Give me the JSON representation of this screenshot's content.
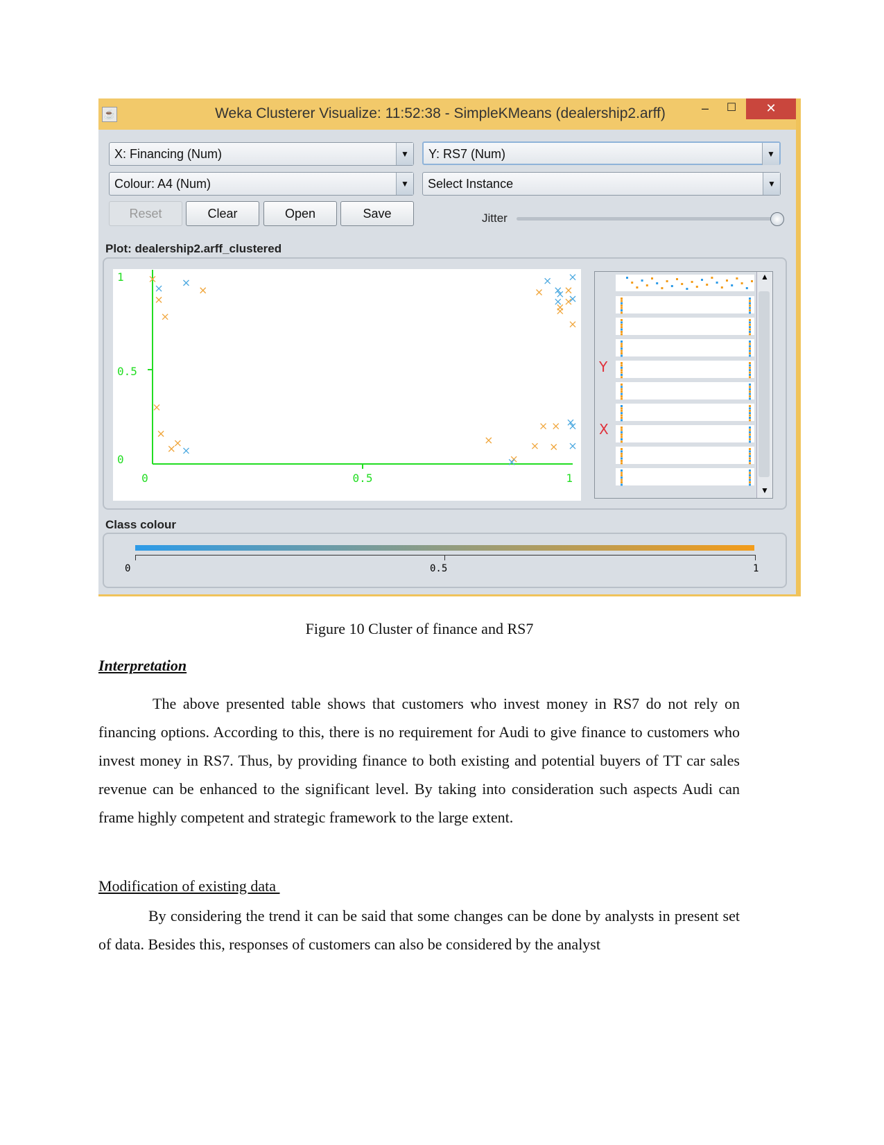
{
  "window": {
    "title": "Weka Clusterer Visualize: 11:52:38 - SimpleKMeans (dealership2.arff)",
    "minimize_glyph": "–",
    "maximize_glyph": "☐",
    "close_glyph": "✕",
    "x_combo": "X: Financing (Num)",
    "y_combo": "Y: RS7 (Num)",
    "colour_combo": "Colour: A4 (Num)",
    "instance_combo": "Select Instance",
    "buttons": {
      "reset": "Reset",
      "clear": "Clear",
      "open": "Open",
      "save": "Save"
    },
    "jitter_label": "Jitter",
    "jitter_value": 1.0,
    "plot_label": "Plot: dealership2.arff_clustered",
    "side_y_label": "Y",
    "side_x_label": "X",
    "class_colour_label": "Class colour",
    "class_colour_ticks": [
      "0",
      "0.5",
      "1"
    ],
    "colors": {
      "low": "#2d9be8",
      "high": "#f39c1a",
      "axis": "#22dd22",
      "titlebar": "#f2c96a"
    }
  },
  "chart_data": {
    "type": "scatter",
    "xlim": [
      0,
      1
    ],
    "ylim": [
      0,
      1
    ],
    "x_ticks": [
      "0",
      "0.5",
      "1"
    ],
    "y_ticks": [
      "0",
      "0.5",
      "1"
    ],
    "series": [
      {
        "color": "#f0a53a",
        "points": [
          [
            0.0,
            0.98
          ],
          [
            0.12,
            0.92
          ],
          [
            0.015,
            0.87
          ],
          [
            0.03,
            0.78
          ],
          [
            0.01,
            0.3
          ],
          [
            0.02,
            0.16
          ],
          [
            0.06,
            0.11
          ],
          [
            0.045,
            0.08
          ],
          [
            0.92,
            0.91
          ],
          [
            0.99,
            0.92
          ],
          [
            0.97,
            0.83
          ],
          [
            0.99,
            0.86
          ],
          [
            0.97,
            0.81
          ],
          [
            1.0,
            0.74
          ],
          [
            0.93,
            0.2
          ],
          [
            0.96,
            0.2
          ],
          [
            0.8,
            0.125
          ],
          [
            0.91,
            0.095
          ],
          [
            0.955,
            0.09
          ],
          [
            0.86,
            0.025
          ]
        ]
      },
      {
        "color": "#4aa8e0",
        "points": [
          [
            0.015,
            0.93
          ],
          [
            0.08,
            0.96
          ],
          [
            0.08,
            0.07
          ],
          [
            0.94,
            0.97
          ],
          [
            1.0,
            0.99
          ],
          [
            0.965,
            0.92
          ],
          [
            0.97,
            0.9
          ],
          [
            1.0,
            0.875
          ],
          [
            0.965,
            0.86
          ],
          [
            0.995,
            0.22
          ],
          [
            1.0,
            0.2
          ],
          [
            1.0,
            0.095
          ],
          [
            0.855,
            0.01
          ]
        ]
      }
    ]
  },
  "document": {
    "caption": "Figure 10 Cluster of finance and RS7",
    "heading1": "Interpretation",
    "para1": "The above presented table shows that customers who invest money in RS7 do not rely on financing options. According to this, there is no requirement for Audi to give finance to customers who invest money in RS7. Thus, by providing finance to both existing and potential buyers of TT car sales revenue can be enhanced to the significant level. By taking into consideration such aspects Audi can frame highly competent and strategic framework to the large extent.",
    "heading2": "Modification of existing data ",
    "para2": "By considering the trend it can be said that some changes can be done by analysts in present set of data. Besides this, responses of customers can also be considered by the analyst"
  }
}
